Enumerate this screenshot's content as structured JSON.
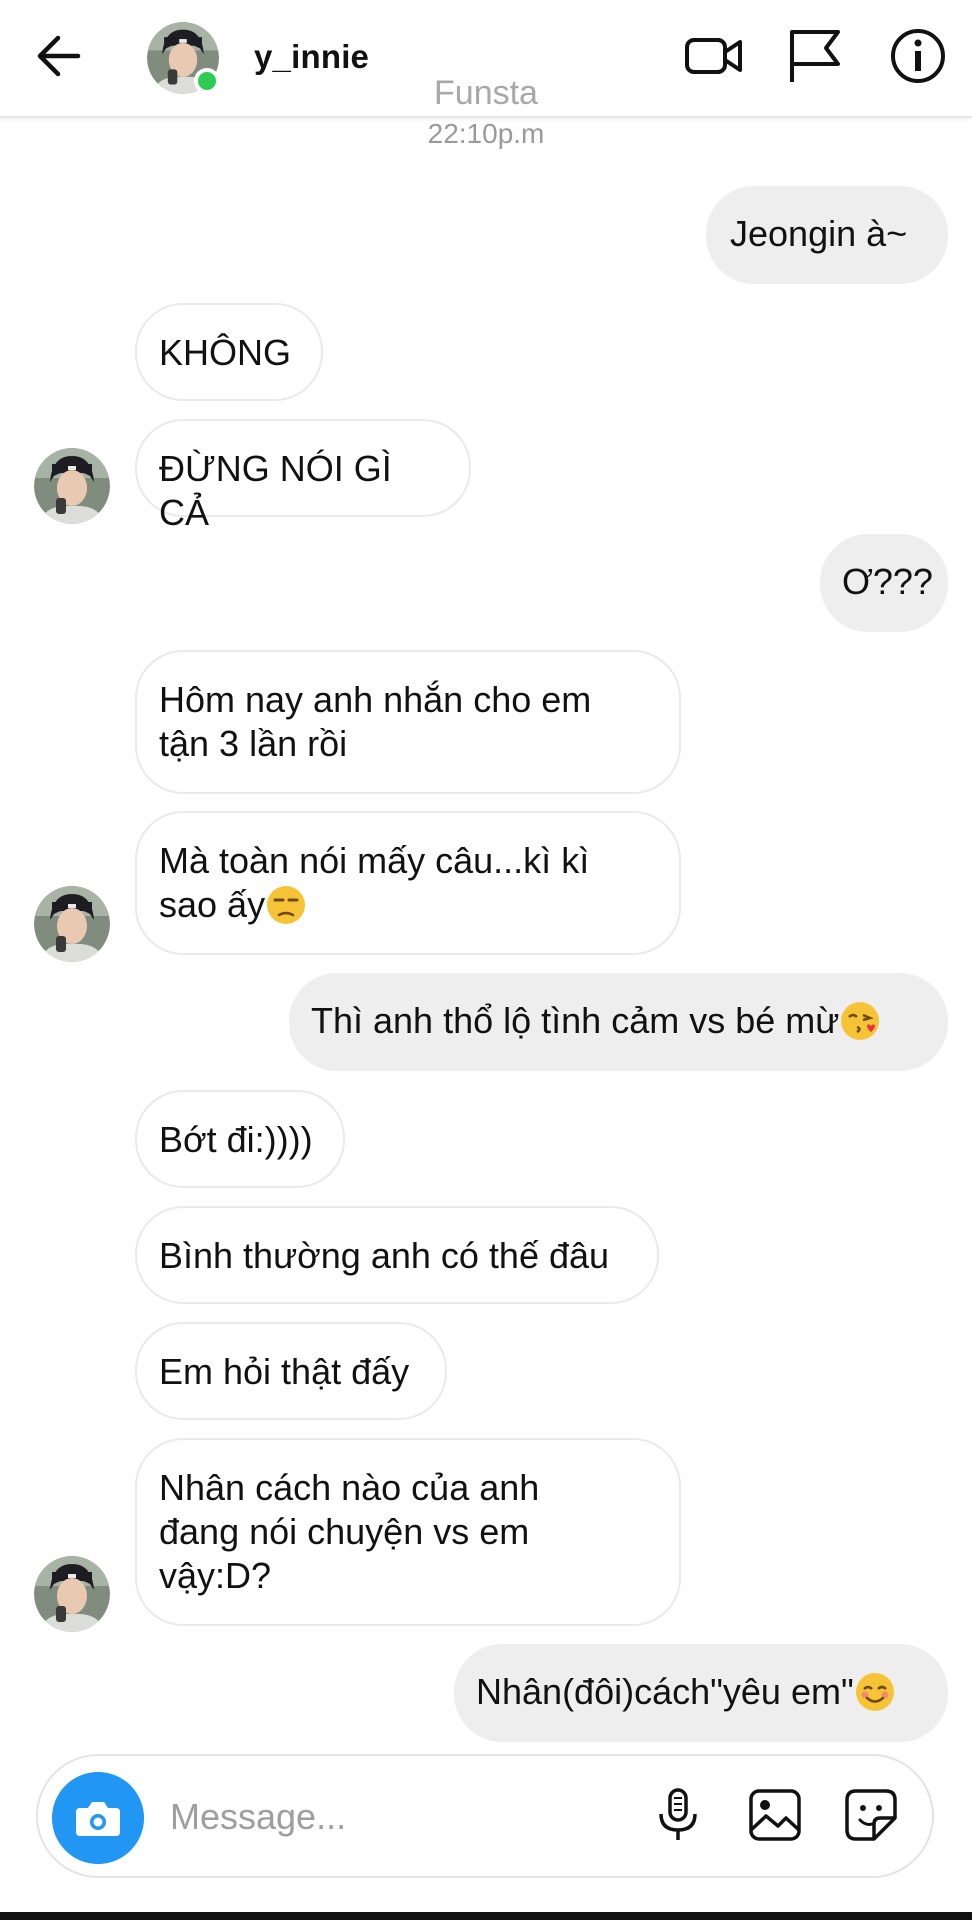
{
  "header": {
    "username": "y_innie",
    "online": true,
    "icons": [
      "back-arrow-icon",
      "video-call-icon",
      "flag-icon",
      "info-icon"
    ]
  },
  "thread": {
    "nickname": "Funsta",
    "timestamp": "22:10p.m"
  },
  "messages": [
    {
      "from": "me",
      "text": "Jeongin à~"
    },
    {
      "from": "them",
      "text": "KHÔNG"
    },
    {
      "from": "them",
      "text": "ĐỪNG NÓI GÌ CẢ",
      "avatar": true
    },
    {
      "from": "me",
      "text": "Ơ???"
    },
    {
      "from": "them",
      "lines": [
        "Hôm nay anh nhắn cho em",
        "tận 3 lần rồi"
      ]
    },
    {
      "from": "them",
      "lines": [
        "Mà toàn nói mấy câu...kì kì",
        "sao ấy"
      ],
      "emoji": "unamused-face-emoji",
      "avatar": true
    },
    {
      "from": "me",
      "text": "Thì anh thổ lộ tình cảm vs bé mừ",
      "emoji": "kissing-face-emoji"
    },
    {
      "from": "them",
      "text": "Bớt đi:))))"
    },
    {
      "from": "them",
      "text": "Bình thường anh có thế đâu"
    },
    {
      "from": "them",
      "text": "Em hỏi thật đấy"
    },
    {
      "from": "them",
      "lines": [
        "Nhân cách nào của anh",
        "đang nói chuyện vs em",
        "vậy:D?"
      ],
      "avatar": true
    },
    {
      "from": "me",
      "text": "Nhân(đôi)cách\"yêu em\"",
      "emoji": "smiling-face-emoji"
    }
  ],
  "composer": {
    "placeholder": "Message...",
    "icons": [
      "camera-icon",
      "microphone-icon",
      "gallery-icon",
      "sticker-icon"
    ]
  },
  "colors": {
    "online": "#2ecc52",
    "camera_button": "#2196f3",
    "outgoing_bubble": "#eeeeee",
    "incoming_border": "#eaeaea"
  }
}
